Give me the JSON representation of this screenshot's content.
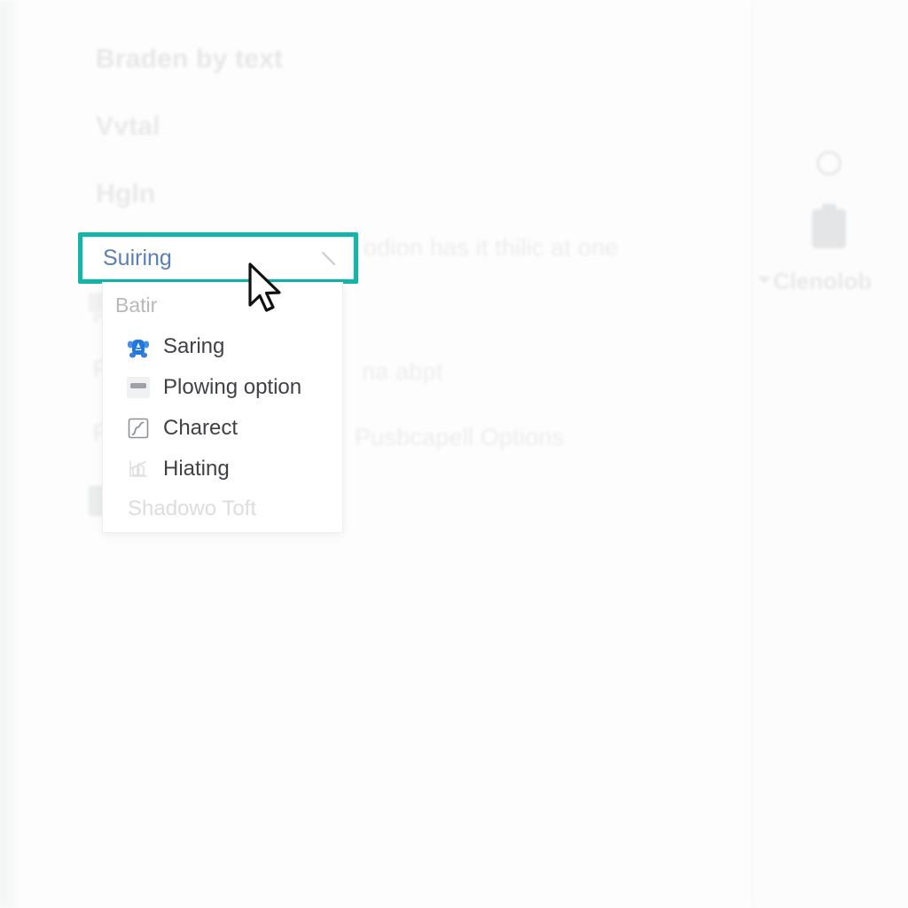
{
  "background": {
    "heading": "Braden by text",
    "label_vvtal": "Vvtal",
    "label_hgln": "Hgln",
    "sentence_right": "odion has it thilic at one",
    "text_na": "na abpt",
    "text_pusb": "Pusbcapell Options",
    "stub_p1": "P",
    "stub_p2": "P",
    "stub_p3": "P"
  },
  "right_pane": {
    "ring_icon": "circle-icon",
    "clipboard_icon": "clipboard-icon",
    "caret_icon": "caret-down-icon",
    "label": "Clenolob"
  },
  "combobox": {
    "value": "Suiring",
    "caret_icon": "chevron-down-icon",
    "focus_color": "#14b4a6",
    "value_color": "#5a7fb5"
  },
  "dropdown": {
    "group_label": "Batir",
    "items": [
      {
        "label": "Saring",
        "icon": "bot-face-icon",
        "disabled": false
      },
      {
        "label": "Plowing option",
        "icon": "slab-icon",
        "disabled": false
      },
      {
        "label": "Charect",
        "icon": "step-curve-icon",
        "disabled": false
      },
      {
        "label": "Hiating",
        "icon": "bar-chart-icon",
        "disabled": false
      }
    ],
    "footer_item": {
      "label": "Shadowo Toft",
      "disabled": true
    }
  },
  "cursor": {
    "type": "arrow-pointer"
  }
}
